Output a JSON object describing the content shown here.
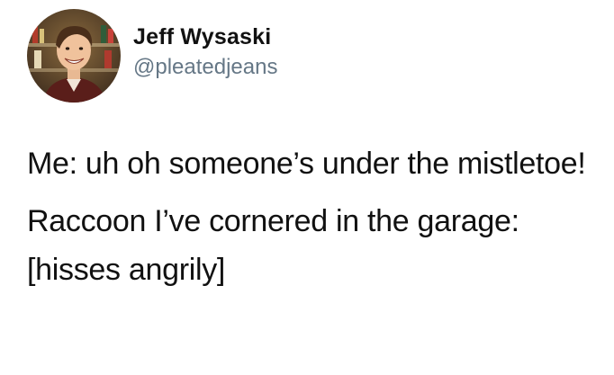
{
  "tweet": {
    "author": {
      "display_name": "Jeff Wysaski",
      "handle": "@pleatedjeans",
      "avatar_icon": "user-avatar-photo"
    },
    "paragraphs": [
      "Me: uh oh someone’s under the mistletoe!",
      "Raccoon I’ve cornered in the garage: [hisses angrily]"
    ]
  },
  "colors": {
    "text": "#111111",
    "handle": "#657786",
    "background": "#ffffff"
  }
}
